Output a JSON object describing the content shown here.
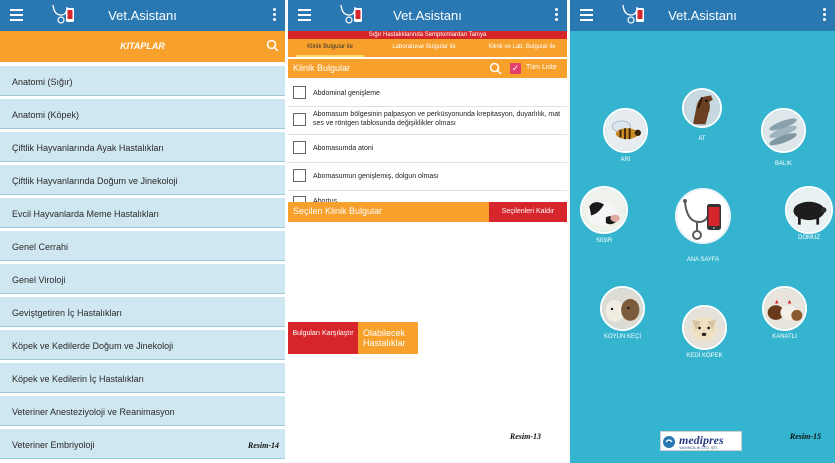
{
  "panel1": {
    "app_title": "Vet.Asistanı",
    "section_title": "KITAPLAR",
    "items": [
      "Anatomi (Sığır)",
      "Anatomi (Köpek)",
      "Çiftlik Hayvanlarında Ayak Hastalıkları",
      "Çiftlik Hayvanlarında Doğum ve Jinekoloji",
      "Evcil Hayvanlarda Meme Hastalıkları",
      "Genel Cerrahi",
      "Genel Viroloji",
      "Geviştgetiren İç Hastalıkları",
      "Köpek ve Kedilerde Doğum ve Jinekoloji",
      "Köpek ve Kedilerin İç Hastalıkları",
      "Veteriner Anesteziyoloji ve Reanimasyon",
      "Veteriner Embriyoloji"
    ],
    "caption": "Resim-14"
  },
  "panel2": {
    "app_title": "Vet.Asistanı",
    "subtitle": "Sığır Hastalıklarında Semptomlardan Tanıya",
    "tabs": [
      "Klinik Bulgular ile",
      "Laboratuvar Bulgular ile",
      "Klinik ve Lab. Bulgular ile"
    ],
    "section_title": "Klinik Bulgular",
    "select_all_label": "Tüm Liste",
    "findings": [
      "Abdominal genişleme",
      "Abomasum bölgesinin palpasyon ve perküsyonunda krepitasyon, duyarlılık, mat ses ve röntgen tablosunda değişiklikler olması",
      "Abomasumda atoni",
      "Abomasumun genişlemiş, dolgun olması",
      "Abortus"
    ],
    "selected_title": "Seçilen Klinik Bulgular",
    "remove_label": "Seçilenleri Kaldır",
    "compare_label": "Bulguları Karşılaştır",
    "possible_label": "Olabilecek Hastalıklar",
    "caption": "Resim-13"
  },
  "panel3": {
    "app_title": "Vet.Asistanı",
    "animals": {
      "ari": "ARI",
      "at": "AT",
      "balik": "BALIK",
      "sigir": "SIGIR",
      "domuz": "DOMUZ",
      "koyun": "KOYUN KEÇİ",
      "kedi": "KEDİ KÖPEK",
      "kanatli": "KANATLI"
    },
    "home_label": "ANA SAYFA",
    "publisher": "medipres",
    "publisher_sub": "YAYINCILIK LTD. ŞTİ.",
    "caption": "Resim-15"
  },
  "colors": {
    "primary": "#2a78b2",
    "accent": "#f7a02c",
    "danger": "#d6262b",
    "background_teal": "#35b4cf",
    "list_item": "#cfe7f1"
  }
}
